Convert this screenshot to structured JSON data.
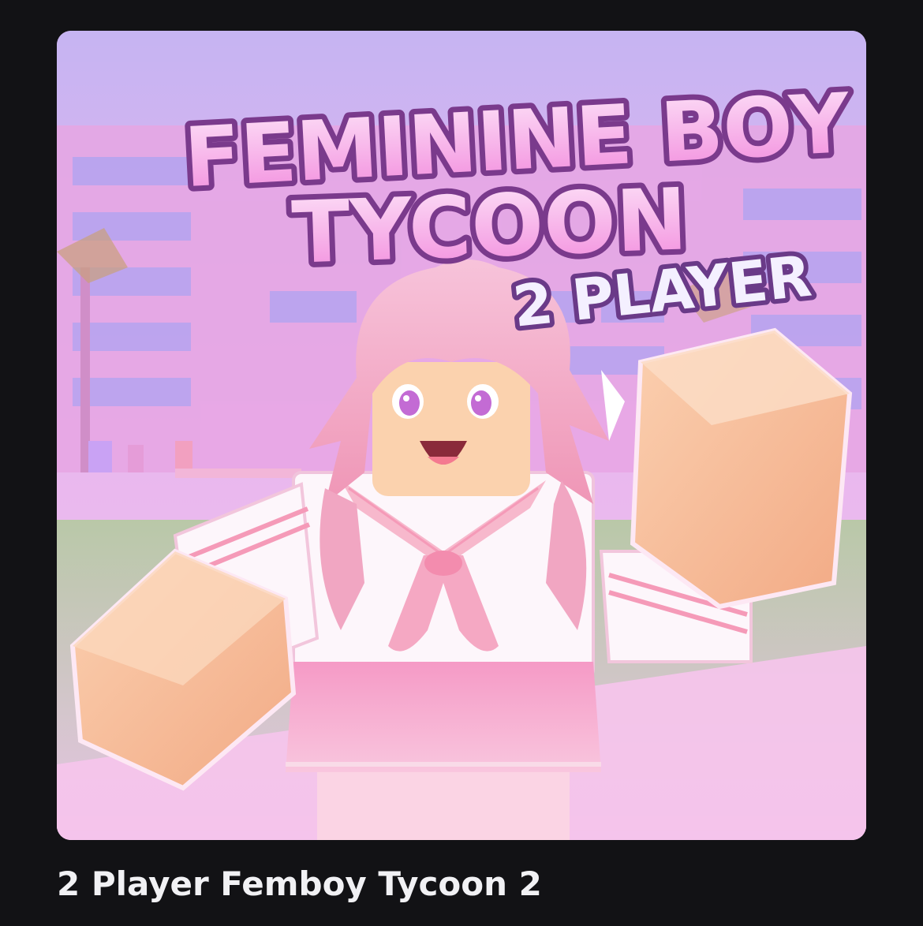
{
  "game": {
    "name": "2 Player Femboy Tycoon 2",
    "thumbnail": {
      "title_line1": "FEMININE BOY",
      "title_line2": "TYCOON",
      "subtitle": "2 PLAYER"
    }
  },
  "colors": {
    "page_background": "#121215",
    "title_fill": "#f7b4ea",
    "title_outline": "#7a3a8c",
    "subtitle_fill": "#f4f0ff",
    "name_text": "#f1f1f4"
  }
}
